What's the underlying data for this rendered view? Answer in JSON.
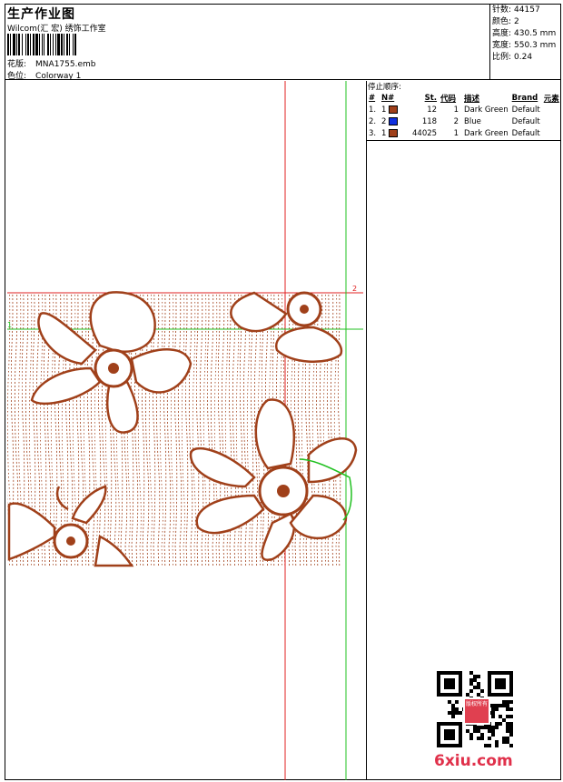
{
  "header": {
    "title": "生产作业图",
    "subtitle": "Wilcom(汇 宏) 绣饰工作室",
    "design_label": "花版:",
    "design_value": "MNA1755.emb",
    "colorway_label": "色位:",
    "colorway_value": "Colorway 1"
  },
  "stats": [
    {
      "label": "针数:",
      "value": "44157"
    },
    {
      "label": "颜色:",
      "value": "2"
    },
    {
      "label": "高度:",
      "value": "430.5 mm"
    },
    {
      "label": "宽度:",
      "value": "550.3 mm"
    },
    {
      "label": "比例:",
      "value": "0.24"
    }
  ],
  "stop_sequence": {
    "label": "停止顺序:",
    "columns": [
      "#",
      "N#",
      "St.",
      "代码",
      "描述",
      "Brand",
      "元素"
    ],
    "rows": [
      {
        "num": "1.",
        "n": "1",
        "swatch": "#a0401a",
        "st": "12",
        "code": "1",
        "desc": "Dark Green",
        "brand": "Default"
      },
      {
        "num": "2.",
        "n": "2",
        "swatch": "#1030e0",
        "st": "118",
        "code": "2",
        "desc": "Blue",
        "brand": "Default"
      },
      {
        "num": "3.",
        "n": "1",
        "swatch": "#a0401a",
        "st": "44025",
        "code": "1",
        "desc": "Dark Green",
        "brand": "Default"
      }
    ]
  },
  "canvas_markers": {
    "one": "1",
    "two": "2"
  },
  "watermark": {
    "site": "6xiu.com",
    "seal": "版权所有"
  },
  "colors": {
    "thread": "#a0401a",
    "guide_red": "#e02020",
    "guide_green": "#20c020"
  }
}
